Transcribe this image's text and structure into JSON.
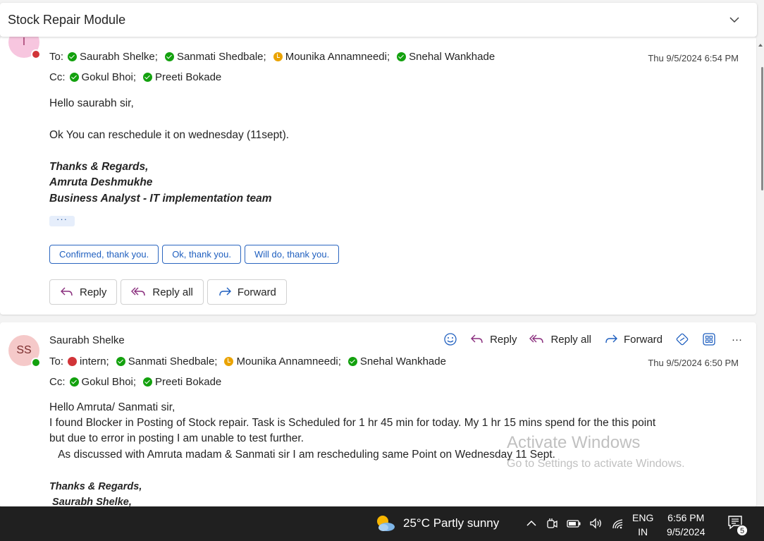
{
  "header": {
    "title": "Stock Repair Module"
  },
  "email1": {
    "avatar_initials": "I",
    "to_label": "To:",
    "to": [
      {
        "name": "Saurabh Shelke;",
        "status": "green"
      },
      {
        "name": "Sanmati Shedbale;",
        "status": "green"
      },
      {
        "name": "Mounika Annamneedi;",
        "status": "yellow"
      },
      {
        "name": "Snehal Wankhade",
        "status": "green"
      }
    ],
    "cc_label": "Cc:",
    "cc": [
      {
        "name": "Gokul Bhoi;",
        "status": "green"
      },
      {
        "name": "Preeti Bokade",
        "status": "green"
      }
    ],
    "date": "Thu 9/5/2024 6:54 PM",
    "greeting": "Hello saurabh sir,",
    "line1": "Ok You can reschedule it on wednesday (11sept).",
    "sig1": "Thanks & Regards,",
    "sig2": "Amruta Deshmukhe",
    "sig3": "Business Analyst - IT implementation team",
    "ellipsis": "···",
    "suggestions": [
      "Confirmed, thank you.",
      "Ok, thank you.",
      "Will do, thank you."
    ],
    "actions": {
      "reply": "Reply",
      "reply_all": "Reply all",
      "forward": "Forward"
    }
  },
  "email2": {
    "avatar_initials": "SS",
    "sender": "Saurabh Shelke",
    "toolbar": {
      "reply": "Reply",
      "reply_all": "Reply all",
      "forward": "Forward",
      "more": "···"
    },
    "to_label": "To:",
    "to": [
      {
        "name": "intern;",
        "status": "red"
      },
      {
        "name": "Sanmati Shedbale;",
        "status": "green"
      },
      {
        "name": "Mounika Annamneedi;",
        "status": "yellow"
      },
      {
        "name": "Snehal Wankhade",
        "status": "green"
      }
    ],
    "cc_label": "Cc:",
    "cc": [
      {
        "name": "Gokul Bhoi;",
        "status": "green"
      },
      {
        "name": "Preeti Bokade",
        "status": "green"
      }
    ],
    "date": "Thu 9/5/2024 6:50 PM",
    "greeting": "Hello Amruta/ Sanmati sir,",
    "line1": "I found Blocker in Posting of Stock repair. Task is Scheduled for 1 hr 45 min for today. My 1 hr 15 mins spend for the this point",
    "line2": "but due to error in posting I am unable to test further.",
    "line3": "   As discussed with Amruta madam & Sanmati sir I am rescheduling same Point on Wednesday 11 Sept.",
    "sig1": "Thanks & Regards,",
    "sig2": " Saurabh Shelke,"
  },
  "watermark": {
    "line1": "Activate Windows",
    "line2": "Go to Settings to activate Windows."
  },
  "taskbar": {
    "weather": "25°C  Partly sunny",
    "lang1": "ENG",
    "lang2": "IN",
    "time": "6:56 PM",
    "date": "9/5/2024",
    "notif_count": "5"
  }
}
